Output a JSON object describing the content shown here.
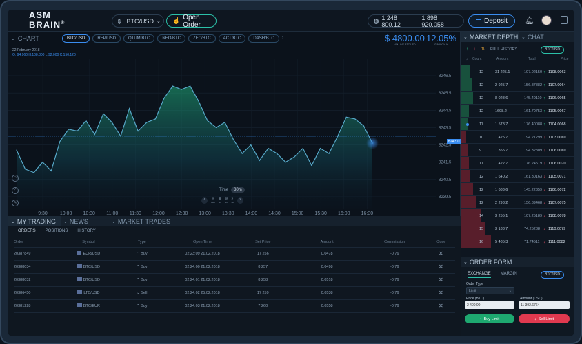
{
  "app": {
    "logo_line1": "ASM",
    "logo_line2": "BRAIN",
    "logo_mark": "®"
  },
  "topbar": {
    "pair": "BTC/USD",
    "open_order": "Open Order",
    "balance1": "1 248 800.12",
    "balance2": "1 898 920.058",
    "deposit": "Deposit"
  },
  "chart": {
    "title": "CHART",
    "tabs": [
      "BTC/USD",
      "REP/USD",
      "QTUM/BTC",
      "NEO/BTC",
      "ZEC/BTC",
      "ACT/BTC",
      "DASH/BTC"
    ],
    "price": "$ 4800.00",
    "price_caption": "VOLUME BTC/USD",
    "growth": "12.05%",
    "growth_caption": "GROWTH %",
    "date": "22 February 2018",
    "ohlc": "O: 94.960  H:108.800  L:92.000  C:150.120",
    "current_label": "8243.0",
    "time_label": "Time",
    "time_value": "30m",
    "zoom_labels": [
      "30m",
      "1h",
      "6h",
      "1d"
    ]
  },
  "chart_data": {
    "type": "area",
    "x": [
      "9:30",
      "10:00",
      "10:30",
      "11:00",
      "11:30",
      "12:00",
      "12:30",
      "13:00",
      "13:30",
      "14:00",
      "14:30",
      "15:00",
      "15:30",
      "16:00",
      "16:30"
    ],
    "y_ticks": [
      "8246.5",
      "8245.5",
      "8244.5",
      "8243.5",
      "8242.5",
      "8241.5",
      "8240.5",
      "8239.5"
    ],
    "ylim": [
      8239.5,
      8246.5
    ],
    "series": [
      {
        "values": [
          8242.2,
          8241.1,
          8240.9,
          8241.5,
          8241.0,
          8242.7,
          8243.4,
          8243.3,
          8243.9,
          8243.1,
          8244.3,
          8243.8,
          8243.0,
          8244.6,
          8243.3,
          8243.8,
          8244.0,
          8245.2,
          8245.9,
          8245.7,
          8245.9,
          8245.0,
          8243.9,
          8243.5,
          8243.8,
          8242.8,
          8242.0,
          8242.5,
          8241.6,
          8242.3,
          8242.0,
          8241.5,
          8241.8,
          8242.3,
          8241.3,
          8242.3,
          8242.0,
          8243.0,
          8244.1,
          8244.0,
          8243.6,
          8242.6
        ]
      }
    ]
  },
  "chart_tools": [
    "magnet-icon",
    "line-tool-icon",
    "brush-icon"
  ],
  "bottom": {
    "panels": [
      "MY TRADING",
      "NEWS",
      "MARKET TRADES"
    ],
    "tabs": [
      "ORDERS",
      "POSITIONS",
      "HISTORY"
    ],
    "columns": [
      "Order",
      "Symbol",
      "Type",
      "Open Time",
      "Set Price",
      "Amount",
      "Commission",
      "Close"
    ],
    "rows": [
      {
        "order": "20387849",
        "symbol": "EUR/USD",
        "type": "Buy",
        "time": "02:23:09  21.02.2018",
        "price": "17 256",
        "amount": "0.0478",
        "commission": "-0.76"
      },
      {
        "order": "20388034",
        "symbol": "BTC/USD",
        "type": "Buy",
        "time": "02:24:00  21.02.2018",
        "price": "8 257",
        "amount": "0.0498",
        "commission": "-0.76"
      },
      {
        "order": "20388032",
        "symbol": "BTC/USD",
        "type": "Buy",
        "time": "02:24:01  21.02.2018",
        "price": "8 258",
        "amount": "0.0518",
        "commission": "-0.76"
      },
      {
        "order": "20386450",
        "symbol": "LTC/USD",
        "type": "Sell",
        "time": "02:24:02  25.02.2018",
        "price": "17 259",
        "amount": "0.0538",
        "commission": "-0.76"
      },
      {
        "order": "20381228",
        "symbol": "BTC/EUR",
        "type": "Buy",
        "time": "02:24:03  21.02.2018",
        "price": "7 260",
        "amount": "0.0558",
        "commission": "-0.76"
      }
    ]
  },
  "depth": {
    "title": "MARKET DEPTH",
    "chat": "CHAT",
    "full_history": "FULL HISTORY",
    "pair": "BTC/USD",
    "columns": [
      "Count",
      "Amount",
      "Total",
      "Price"
    ],
    "rows": [
      {
        "count": "12",
        "amount": "31 225.1",
        "total": "107.02150",
        "price": "1108.0063",
        "side": "buy"
      },
      {
        "count": "12",
        "amount": "2 925.7",
        "total": "156.87882",
        "price": "1107.0064",
        "side": "buy"
      },
      {
        "count": "12",
        "amount": "8 028.6",
        "total": "145.40110",
        "price": "1106.0065",
        "side": "buy"
      },
      {
        "count": "12",
        "amount": "1698.2",
        "total": "161.70753",
        "price": "1105.0067",
        "side": "buy"
      },
      {
        "count": "11",
        "amount": "1 578.7",
        "total": "176.40088",
        "price": "1104.0068",
        "side": "buy"
      },
      {
        "count": "10",
        "amount": "1 425.7",
        "total": "194.21299",
        "price": "1103.0069",
        "side": "sell"
      },
      {
        "count": "9",
        "amount": "1 355.7",
        "total": "194.32809",
        "price": "1106.0069",
        "side": "sell"
      },
      {
        "count": "11",
        "amount": "1 422.7",
        "total": "176.24519",
        "price": "1106.0070",
        "side": "sell"
      },
      {
        "count": "12",
        "amount": "1 640.2",
        "total": "161.30163",
        "price": "1105.0071",
        "side": "sell"
      },
      {
        "count": "12",
        "amount": "1 683.6",
        "total": "145.22359",
        "price": "1106.0072",
        "side": "sell"
      },
      {
        "count": "12",
        "amount": "2 298.2",
        "total": "156.89468",
        "price": "1107.0075",
        "side": "sell"
      },
      {
        "count": "14",
        "amount": "3 255.1",
        "total": "107.25189",
        "price": "1108.0078",
        "side": "sell"
      },
      {
        "count": "15",
        "amount": "3 188.7",
        "total": "74.25288",
        "price": "1110.0079",
        "side": "sell"
      },
      {
        "count": "16",
        "amount": "5 485.3",
        "total": "71.74511",
        "price": "1111.0082",
        "side": "sell"
      }
    ]
  },
  "order_form": {
    "title": "ORDER FORM",
    "tabs": [
      "EXCHANGE",
      "MARGIN"
    ],
    "pair": "BTC/USD",
    "order_type_label": "Order Type",
    "order_type_value": "Limit",
    "price_label": "Price (BTC)",
    "price_value": "2 400.00",
    "amount_label": "Amount (USD)",
    "amount_value": "11 392.6764",
    "buy": "Buy Limit",
    "sell": "Sell Limit"
  }
}
